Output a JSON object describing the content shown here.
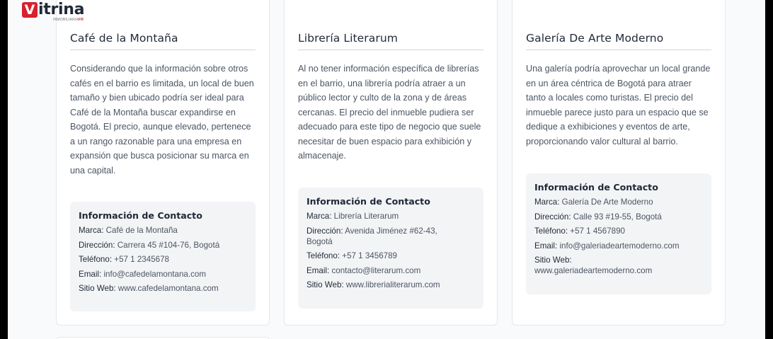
{
  "brand": {
    "name": "Vitrina",
    "logo_letter": "V",
    "logo_rest": "itrina",
    "sub_a": "INMOBILIARIA",
    "sub_b": "FR",
    "accent": "#d8212c"
  },
  "contact_heading": "Información de Contacto",
  "labels": {
    "brand": "Marca:",
    "address": "Dirección:",
    "phone": "Teléfono:",
    "email": "Email:",
    "website": "Sitio Web:"
  },
  "cards": [
    {
      "title": "Café de la Montaña",
      "description": "Considerando que la información sobre otros cafés en el barrio es limitada, un local de buen tamaño y bien ubicado podría ser ideal para Café de la Montaña buscar expandirse en Bogotá. El precio, aunque elevado, pertenece a un rango razonable para una empresa en expansión que busca posicionar su marca en una capital.",
      "brand": "Café de la Montaña",
      "address": "Carrera 45 #104-76, Bogotá",
      "phone": "+57 1 2345678",
      "email": "info@cafedelamontana.com",
      "website": "www.cafedelamontana.com"
    },
    {
      "title": "Librería Literarum",
      "description": "Al no tener información específica de librerías en el barrio, una librería podría atraer a un público lector y culto de la zona y de áreas cercanas. El precio del inmueble pudiera ser adecuado para este tipo de negocio que suele necesitar de buen espacio para exhibición y almacenaje.",
      "brand": "Librería Literarum",
      "address": "Avenida Jiménez #62-43, Bogotá",
      "phone": "+57 1 3456789",
      "email": "contacto@literarum.com",
      "website": "www.librerialiterarum.com"
    },
    {
      "title": "Galería De Arte Moderno",
      "description": "Una galería podría aprovechar un local grande en un área céntrica de Bogotá para atraer tanto a locales como turistas. El precio del inmueble parece justo para un espacio que se dedique a exhibiciones y eventos de arte, proporcionando valor cultural al barrio.",
      "brand": "Galería De Arte Moderno",
      "address": "Calle 93 #19-55, Bogotá",
      "phone": "+57 1 4567890",
      "email": "info@galeriadeartemoderno.com",
      "website": "www.galeriadeartemoderno.com"
    }
  ]
}
